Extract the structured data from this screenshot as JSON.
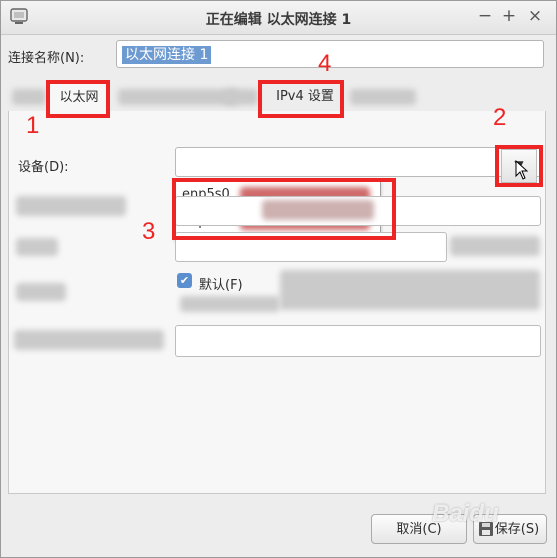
{
  "window": {
    "title": "正在编辑 以太网连接 1",
    "minimize": "−",
    "maximize": "+",
    "close": "×"
  },
  "connection": {
    "name_label": "连接名称(N):",
    "name_value": "以太网连接 1"
  },
  "tabs": [
    {
      "label": "以太网",
      "active": true
    },
    {
      "label": "IPv4 设置",
      "active": false
    }
  ],
  "ethernet": {
    "device_label": "设备(D):",
    "device_options": [
      "enp5s0",
      "enp6s0"
    ],
    "default_checkbox": {
      "label": "默认(F)",
      "checked": true
    }
  },
  "footer": {
    "cancel": "取消(C)",
    "save": "保存(S)"
  },
  "annotations": {
    "n1": "1",
    "n2": "2",
    "n3": "3",
    "n4": "4",
    "color": "#ee2525"
  },
  "watermark": "Baidu"
}
